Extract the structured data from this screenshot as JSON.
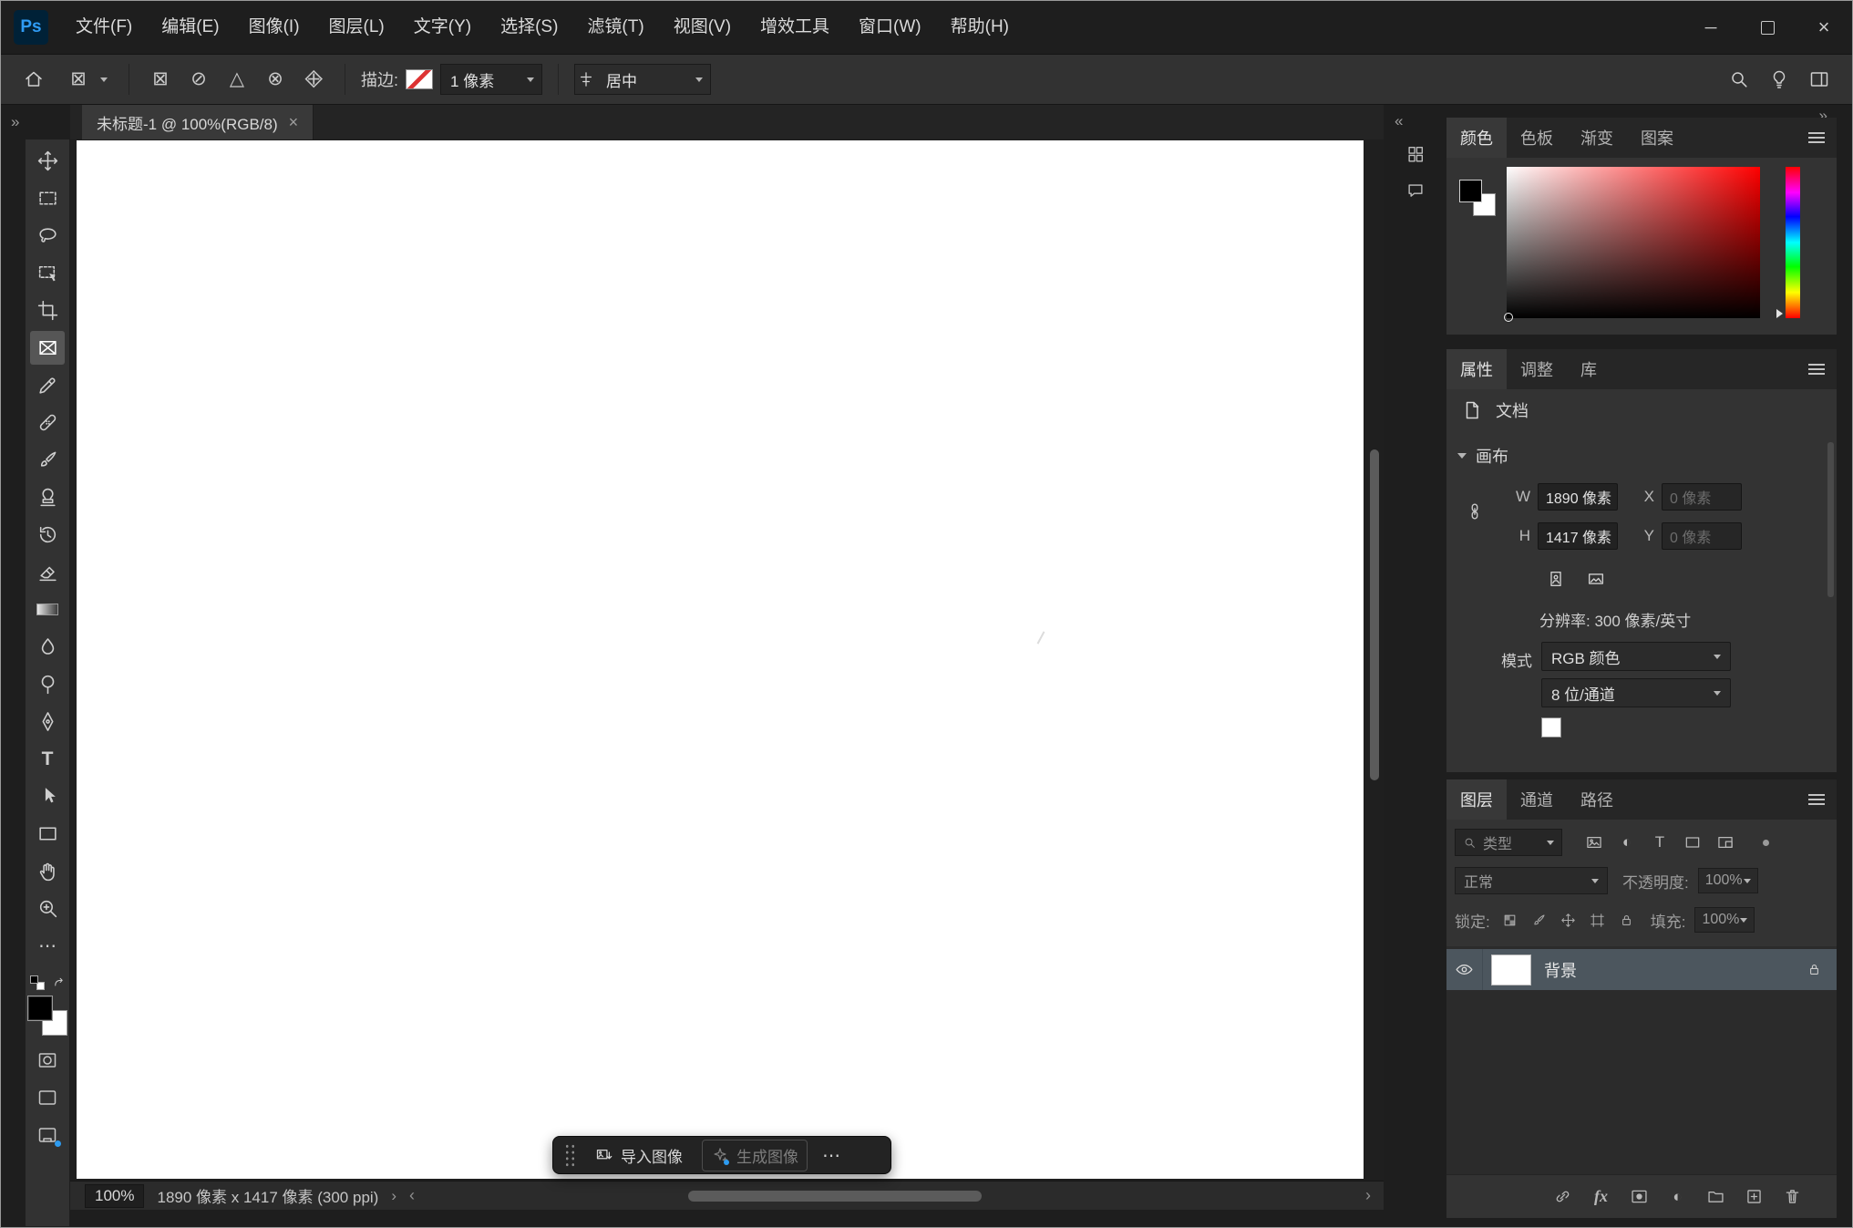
{
  "menu_bar": {
    "logo": "Ps",
    "items": [
      "文件(F)",
      "编辑(E)",
      "图像(I)",
      "图层(L)",
      "文字(Y)",
      "选择(S)",
      "滤镜(T)",
      "视图(V)",
      "增效工具",
      "窗口(W)",
      "帮助(H)"
    ]
  },
  "window_controls": {
    "minimize": "─",
    "close": "×"
  },
  "options_bar": {
    "stroke_label": "描边:",
    "stroke_width": "1 像素",
    "align_value": "居中"
  },
  "document_tab": {
    "title": "未标题-1 @ 100%(RGB/8)",
    "close": "×"
  },
  "status_bar": {
    "zoom": "100%",
    "doc_info": "1890 像素 x 1417 像素 (300 ppi)"
  },
  "taskbar": {
    "import": "导入图像",
    "generate": "生成图像",
    "more": "⋯"
  },
  "panels": {
    "color": {
      "tabs": [
        "颜色",
        "色板",
        "渐变",
        "图案"
      ]
    },
    "properties": {
      "tabs": [
        "属性",
        "调整",
        "库"
      ],
      "document_label": "文档",
      "canvas_section": "画布",
      "w_label": "W",
      "w_value": "1890 像素",
      "x_label": "X",
      "x_value": "0 像素",
      "h_label": "H",
      "h_value": "1417 像素",
      "y_label": "Y",
      "y_value": "0 像素",
      "resolution": "分辨率: 300 像素/英寸",
      "mode_label": "模式",
      "mode_value": "RGB 颜色",
      "depth_value": "8 位/通道"
    },
    "layers": {
      "tabs": [
        "图层",
        "通道",
        "路径"
      ],
      "filter_label": "类型",
      "blend_mode": "正常",
      "opacity_label": "不透明度:",
      "opacity_value": "100%",
      "lock_label": "锁定:",
      "fill_label": "填充:",
      "fill_value": "100%",
      "layer_name": "背景"
    }
  },
  "icons": {
    "toolbar_expand": "»",
    "strip_collapse": "«",
    "dock_collapse": "»",
    "preset_tool": "⊠",
    "frame_rect": "⊠",
    "frame_ellipse": "⊘",
    "frame_triangle": "△",
    "frame_circle_x": "⊗",
    "frame_diamond": "⊠",
    "type_tool": "T",
    "more_tools": "⋯",
    "status_popup": "›",
    "scroll_left": "‹",
    "scroll_right": "›",
    "fx": "fx",
    "adjustment_half_circle": "◐",
    "filter_type": "T"
  },
  "colors": {
    "accent_blue": "#2d9bf0",
    "foreground_color": "#000000",
    "background_color": "#ffffff",
    "canvas_color": "#ffffff"
  }
}
